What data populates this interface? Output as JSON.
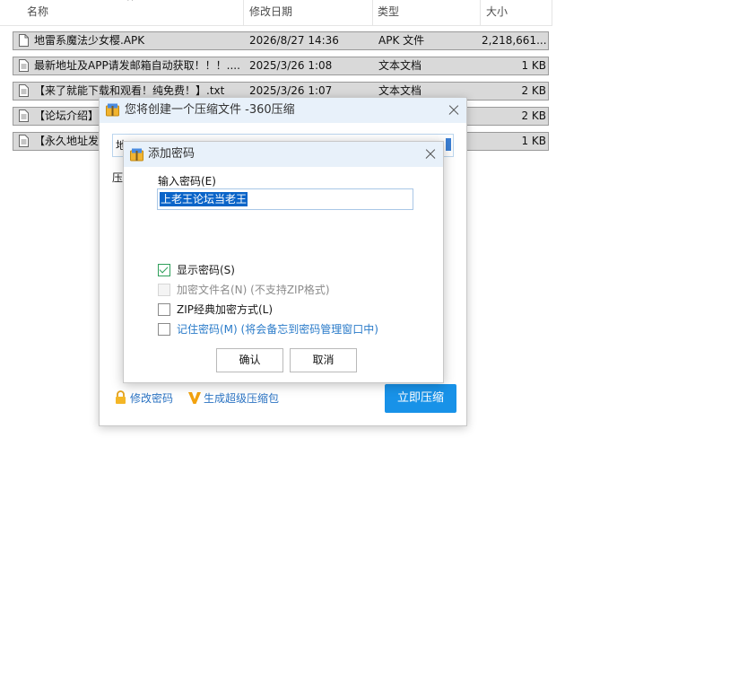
{
  "explorer": {
    "columns": {
      "name": "名称",
      "date": "修改日期",
      "type": "类型",
      "size": "大小"
    },
    "files": [
      {
        "name": "地雷系魔法少女樱.APK",
        "date": "2026/8/27 14:36",
        "type": "APK 文件",
        "size": "2,218,661...",
        "icon": "file-icon"
      },
      {
        "name": "最新地址及APP请发邮箱自动获取！！！....",
        "date": "2025/3/26 1:08",
        "type": "文本文档",
        "size": "1 KB",
        "icon": "text-file-icon"
      },
      {
        "name": "【来了就能下载和观看！纯免费！】.txt",
        "date": "2025/3/26 1:07",
        "type": "文本文档",
        "size": "2 KB",
        "icon": "text-file-icon"
      },
      {
        "name": "【论坛介绍】",
        "date": "",
        "type": "",
        "size": "2 KB",
        "icon": "text-file-icon"
      },
      {
        "name": "【永久地址发",
        "date": "",
        "type": "",
        "size": "1 KB",
        "icon": "text-file-icon"
      }
    ]
  },
  "compress_window": {
    "title": "您将创建一个压缩文件 -360压缩",
    "path_prefix": "地",
    "form_prefix": "压",
    "change_password_link": "修改密码",
    "super_package_link": "生成超级压缩包",
    "compress_button": "立即压缩"
  },
  "password_dialog": {
    "title": "添加密码",
    "input_label": "输入密码(E)",
    "password_value": "上老王论坛当老王",
    "options": [
      {
        "label": "显示密码(S)",
        "checked": true,
        "enabled": true
      },
      {
        "label": "加密文件名(N) (不支持ZIP格式)",
        "checked": false,
        "enabled": false
      },
      {
        "label": "ZIP经典加密方式(L)",
        "checked": false,
        "enabled": true
      },
      {
        "label": "记住密码(M) (将会备忘到密码管理窗口中)",
        "checked": false,
        "enabled": true
      }
    ],
    "ok_button": "确认",
    "cancel_button": "取消"
  },
  "colors": {
    "accent": "#1892e8",
    "titlebar": "#e8f1fa",
    "selection": "#0a64c8",
    "link": "#2b73c2",
    "row_selected": "#d9d9d9"
  }
}
